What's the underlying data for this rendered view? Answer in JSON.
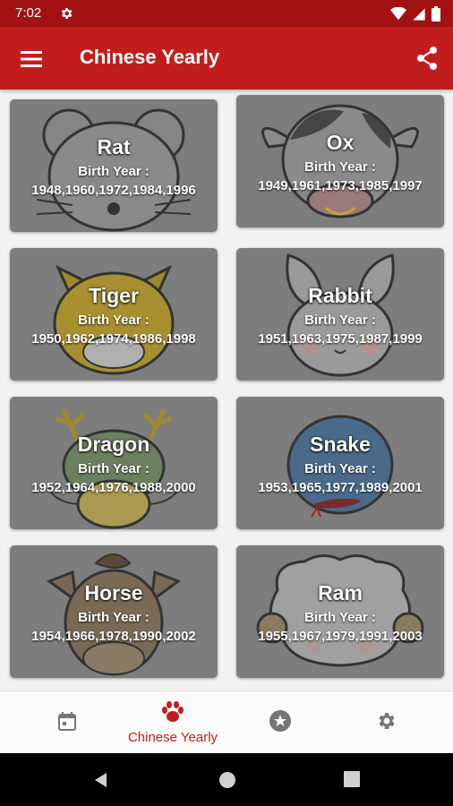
{
  "status": {
    "time": "7:02"
  },
  "app_bar": {
    "title": "Chinese Yearly"
  },
  "cards": [
    {
      "name": "Rat",
      "label": "Birth Year :",
      "years": "1948,1960,1972,1984,1996"
    },
    {
      "name": "Ox",
      "label": "Birth Year :",
      "years": "1949,1961,1973,1985,1997"
    },
    {
      "name": "Tiger",
      "label": "Birth Year :",
      "years": "1950,1962,1974,1986,1998"
    },
    {
      "name": "Rabbit",
      "label": "Birth Year :",
      "years": "1951,1963,1975,1987,1999"
    },
    {
      "name": "Dragon",
      "label": "Birth Year :",
      "years": "1952,1964,1976,1988,2000"
    },
    {
      "name": "Snake",
      "label": "Birth Year :",
      "years": "1953,1965,1977,1989,2001"
    },
    {
      "name": "Horse",
      "label": "Birth Year :",
      "years": "1954,1966,1978,1990,2002"
    },
    {
      "name": "Ram",
      "label": "Birth Year :",
      "years": "1955,1967,1979,1991,2003"
    }
  ],
  "bottom_nav": {
    "items": [
      {
        "icon": "calendar-icon",
        "label": ""
      },
      {
        "icon": "paw-icon",
        "label": "Chinese Yearly"
      },
      {
        "icon": "star-icon",
        "label": ""
      },
      {
        "icon": "gear-icon",
        "label": ""
      }
    ],
    "active_index": 1
  },
  "colors": {
    "primary": "#c21d1d",
    "status_bar": "#a31212",
    "card_overlay": "#7d7d7d"
  }
}
